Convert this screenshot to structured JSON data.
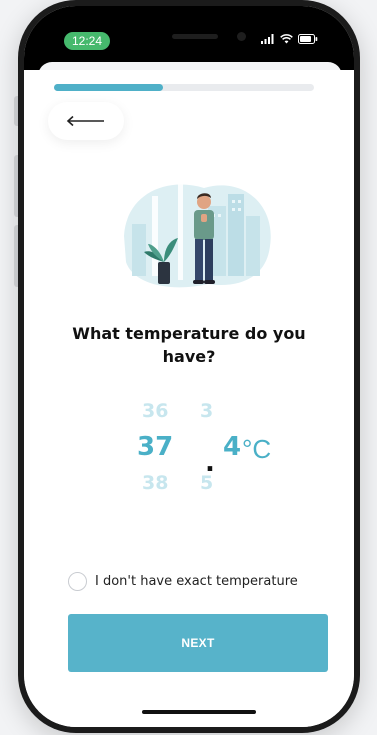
{
  "status_bar": {
    "time": "12:24"
  },
  "progress": {
    "fraction": 0.42
  },
  "question": {
    "title": "What temperature do you have?"
  },
  "picker": {
    "integer_prev": "36",
    "integer_selected": "37",
    "integer_next": "38",
    "separator": ".",
    "decimal_prev": "3",
    "decimal_selected": "4",
    "decimal_next": "5",
    "unit": "°C"
  },
  "checkbox": {
    "label": "I don't have exact temperature"
  },
  "next_button": {
    "label": "NEXT"
  },
  "colors": {
    "accent": "#4fb0c8",
    "button": "#57b3ca",
    "status_pill": "#46b96d"
  }
}
